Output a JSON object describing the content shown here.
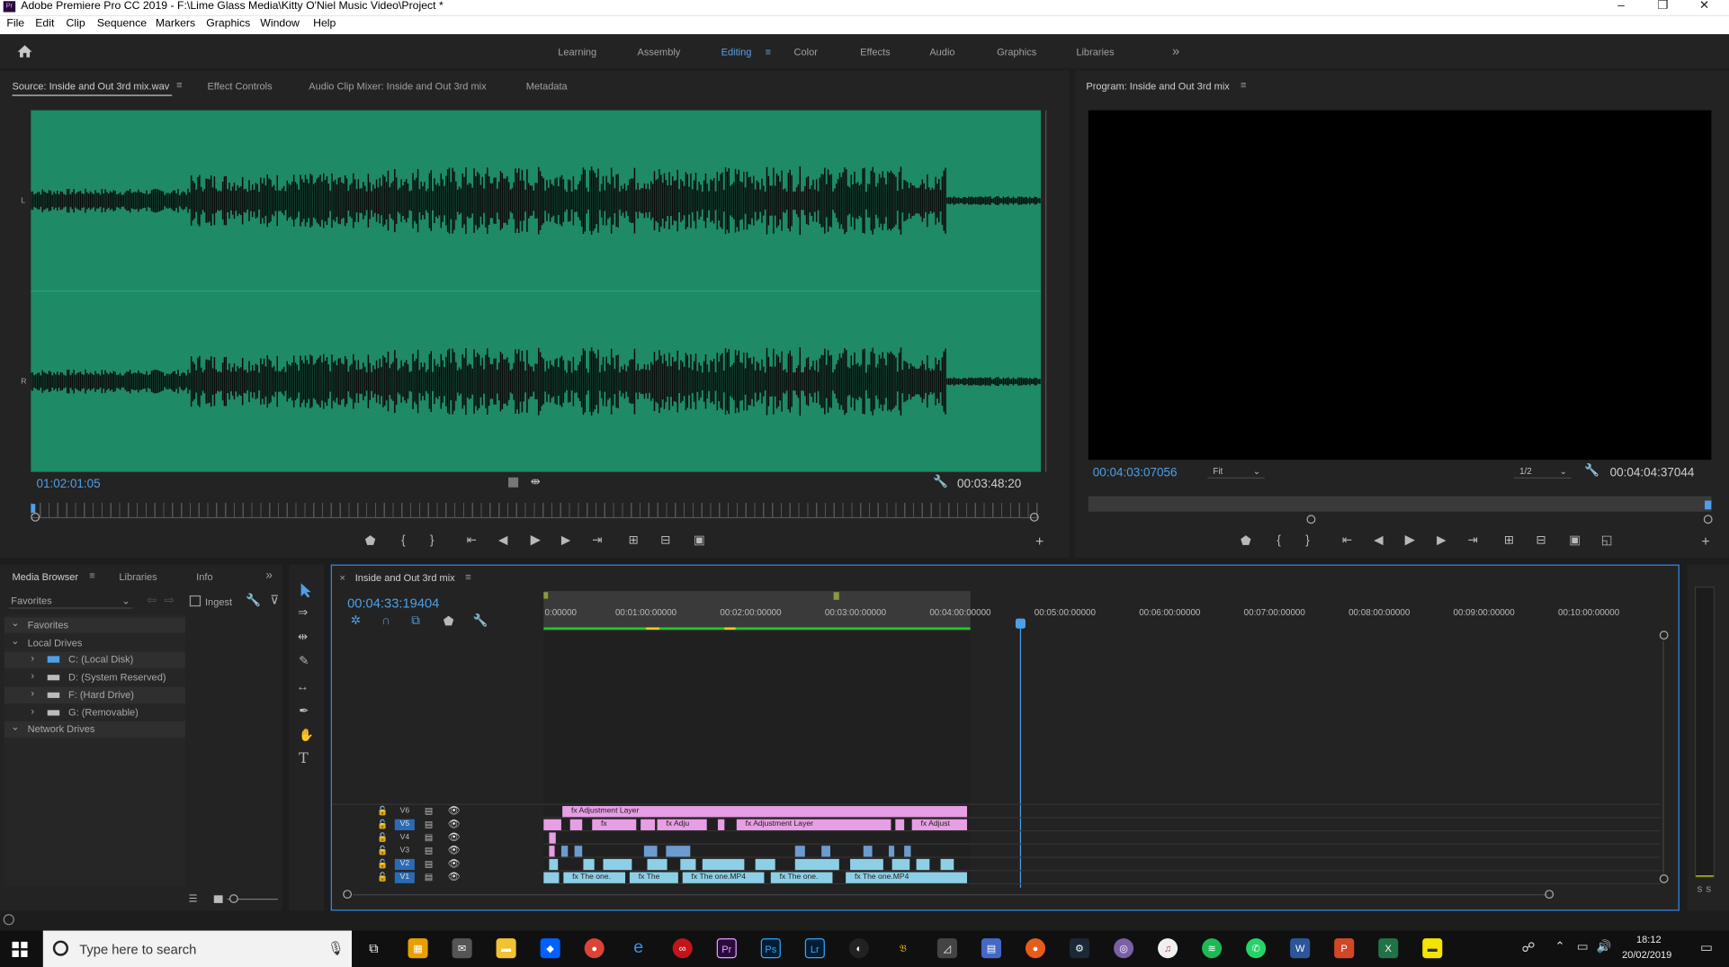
{
  "window": {
    "title": "Adobe Premiere Pro CC 2019 - F:\\Lime Glass Media\\Kitty O'Niel Music Video\\Project *",
    "app_badge": "Pr",
    "min": "–",
    "restore": "❐",
    "close": "✕"
  },
  "menu": [
    "File",
    "Edit",
    "Clip",
    "Sequence",
    "Markers",
    "Graphics",
    "Window",
    "Help"
  ],
  "workspaces": {
    "items": [
      "Learning",
      "Assembly",
      "Editing",
      "Color",
      "Effects",
      "Audio",
      "Graphics",
      "Libraries"
    ],
    "active": "Editing",
    "more": "»"
  },
  "source": {
    "tabs": [
      "Source: Inside and Out 3rd mix.wav",
      "Effect Controls",
      "Audio Clip Mixer: Inside and Out 3rd mix",
      "Metadata"
    ],
    "timecode": "01:02:01:05",
    "duration": "00:03:48:20",
    "ch_l": "L",
    "ch_r": "R"
  },
  "program": {
    "title": "Program: Inside and Out 3rd mix",
    "timecode": "00:04:03:07056",
    "fit": "Fit",
    "resolution": "1/2",
    "duration": "00:04:04:37044"
  },
  "media_browser": {
    "tabs": [
      "Media Browser",
      "Libraries",
      "Info"
    ],
    "favorites_select": "Favorites",
    "ingest": "Ingest",
    "tree": {
      "favorites": "Favorites",
      "local": "Local Drives",
      "drives": [
        "C: (Local Disk)",
        "D: (System Reserved)",
        "F: (Hard Drive)",
        "G: (Removable)"
      ],
      "network": "Network Drives"
    }
  },
  "timeline": {
    "title": "Inside and Out 3rd mix",
    "timecode": "00:04:33:19404",
    "ruler": [
      "0:00000",
      "00:01:00:00000",
      "00:02:00:00000",
      "00:03:00:00000",
      "00:04:00:00000",
      "00:05:00:00000",
      "00:06:00:00000",
      "00:07:00:00000",
      "00:08:00:00000",
      "00:09:00:00000",
      "00:10:00:00000"
    ],
    "tracks": [
      "V6",
      "V5",
      "V4",
      "V3",
      "V2",
      "V1"
    ],
    "clips": {
      "adj_layer": "Adjustment Layer",
      "adj_short": "Adju",
      "adj_short2": "Adjust",
      "the_one": "The one.",
      "the": "The",
      "the_one_mp4": "The one.MP4",
      "the_one2": "The one.",
      "the_one_mp4_2": "The one.MP4",
      "fx": "fx"
    }
  },
  "audio_meter": {
    "labels": [
      "S",
      "S"
    ]
  },
  "taskbar": {
    "search_placeholder": "Type here to search",
    "time": "18:12",
    "date": "20/02/2019"
  }
}
